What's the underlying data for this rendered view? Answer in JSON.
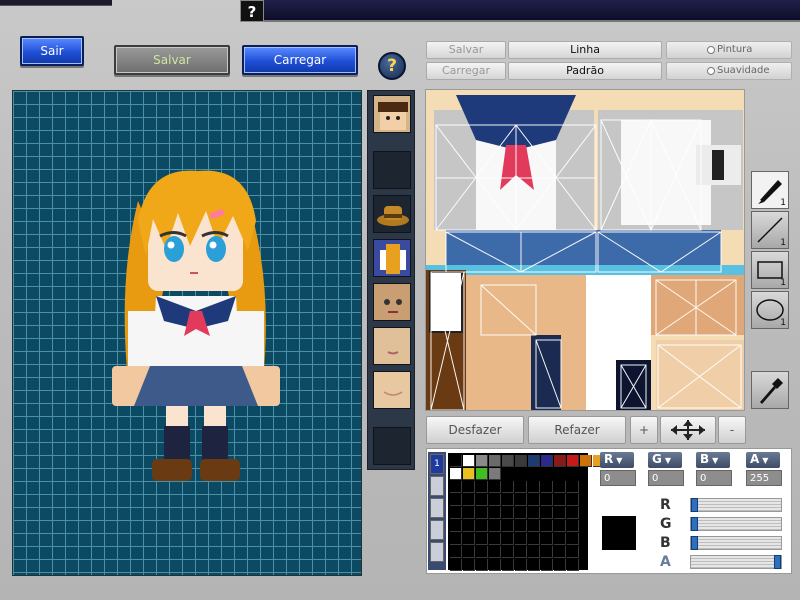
{
  "topbar": {
    "help_glyph": "?"
  },
  "buttons": {
    "sair": "Sair",
    "salvar": "Salvar",
    "carregar": "Carregar",
    "help_glyph": "?"
  },
  "texture_toolbar": {
    "salvar": "Salvar",
    "carregar": "Carregar",
    "linha": "Linha",
    "padrao": "Padrão",
    "pintura": "Pintura",
    "suavidade": "Suavidade"
  },
  "tools": {
    "pen_count": "1",
    "line_count": "1",
    "rect_count": "1",
    "ellipse_count": "1"
  },
  "edit": {
    "desfazer": "Desfazer",
    "refazer": "Refazer",
    "plus": "+",
    "minus": "-"
  },
  "layers": {
    "active": "1"
  },
  "palette": {
    "row1": [
      "#000000",
      "#ffffff",
      "#8a8a8a",
      "#6a6a6a",
      "#4a4a4a",
      "#3a3a3a",
      "#1f3a6e",
      "#2a2a8a",
      "#8a1a1a",
      "#c41a1a",
      "#d0700a",
      "#e8a020"
    ],
    "row2": [
      "#ffffff",
      "#e8c020",
      "#40c020",
      "#7a7a7a"
    ],
    "current": "#000000"
  },
  "channels": {
    "r": {
      "label": "R",
      "value": "0"
    },
    "g": {
      "label": "G",
      "value": "0"
    },
    "b": {
      "label": "B",
      "value": "0"
    },
    "a": {
      "label": "A",
      "value": "255"
    }
  },
  "sliders": {
    "r": {
      "label": "R",
      "level": 0
    },
    "g": {
      "label": "G",
      "level": 0
    },
    "b": {
      "label": "B",
      "level": 0
    },
    "a": {
      "label": "A",
      "level": 1
    }
  }
}
